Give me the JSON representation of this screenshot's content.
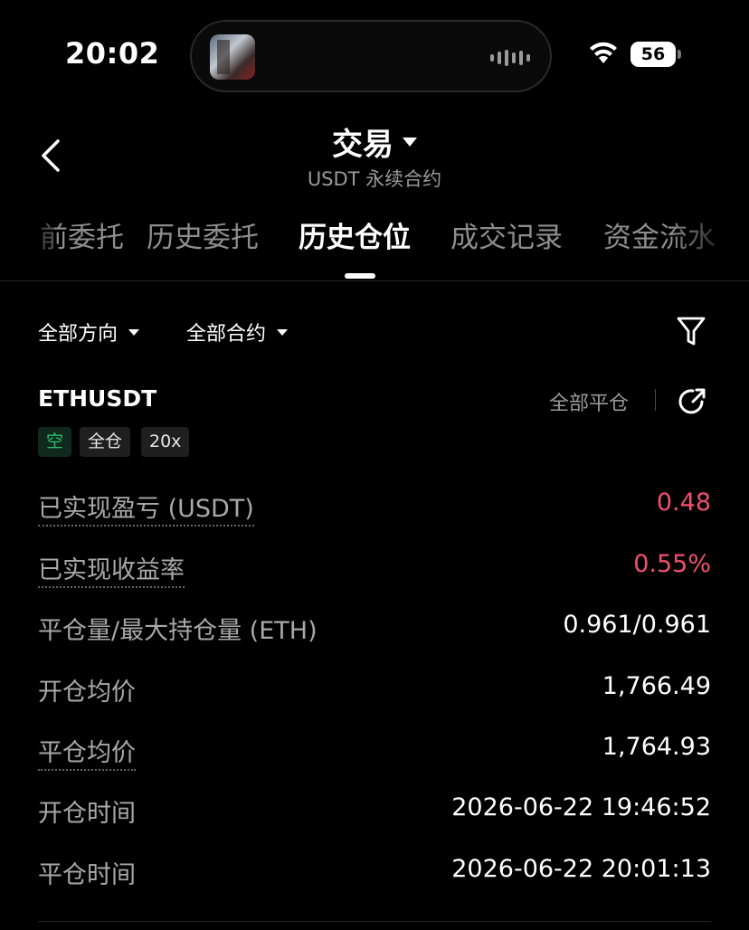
{
  "status_bar": {
    "time": "20:02",
    "battery": "56",
    "wifi_icon": "wifi-icon",
    "island_app_icon": "game-app-icon"
  },
  "header": {
    "title": "交易",
    "subtitle": "USDT 永续合约",
    "back_icon": "chevron-left-icon"
  },
  "tabs": [
    {
      "label": "前委托",
      "active": false
    },
    {
      "label": "历史委托",
      "active": false
    },
    {
      "label": "历史仓位",
      "active": true
    },
    {
      "label": "成交记录",
      "active": false
    },
    {
      "label": "资金流水",
      "active": false
    }
  ],
  "filters": {
    "direction": "全部方向",
    "contract": "全部合约",
    "filter_icon": "funnel-icon"
  },
  "position": {
    "symbol": "ETHUSDT",
    "close_all": "全部平仓",
    "share_icon": "share-icon",
    "tags": {
      "side": "空",
      "margin_mode": "全仓",
      "leverage": "20x"
    },
    "rows": [
      {
        "label": "已实现盈亏 (USDT)",
        "value": "0.48"
      },
      {
        "label": "已实现收益率",
        "value": "0.55%"
      },
      {
        "label": "平仓量/最大持仓量 (ETH)",
        "value": "0.961/0.961"
      },
      {
        "label": "开仓均价",
        "value": "1,766.49"
      },
      {
        "label": "平仓均价",
        "value": "1,764.93"
      },
      {
        "label": "开仓时间",
        "value": "2026-06-22 19:46:52"
      },
      {
        "label": "平仓时间",
        "value": "2026-06-22 20:01:13"
      }
    ]
  },
  "colors": {
    "background": "#000000",
    "profit_red": "#f0506e",
    "short_green": "#2fbf74",
    "muted_text": "#a9a9a9"
  }
}
